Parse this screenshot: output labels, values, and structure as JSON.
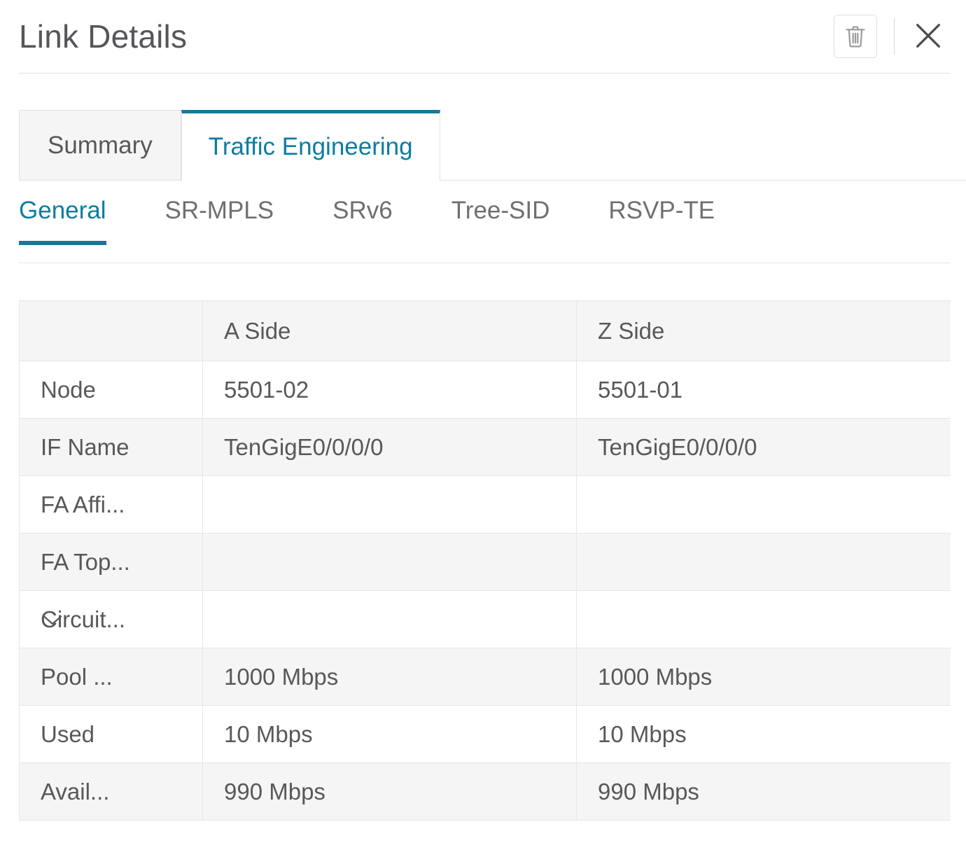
{
  "header": {
    "title": "Link Details",
    "delete_icon": "trash-icon",
    "close_icon": "close-icon"
  },
  "tabs": [
    {
      "label": "Summary",
      "active": false
    },
    {
      "label": "Traffic Engineering",
      "active": true
    }
  ],
  "subtabs": [
    {
      "label": "General",
      "active": true
    },
    {
      "label": "SR-MPLS",
      "active": false
    },
    {
      "label": "SRv6",
      "active": false
    },
    {
      "label": "Tree-SID",
      "active": false
    },
    {
      "label": "RSVP-TE",
      "active": false
    }
  ],
  "table": {
    "columns": [
      "",
      "A Side",
      "Z Side"
    ],
    "rows": [
      {
        "label": "Node",
        "a": "5501-02",
        "z": "5501-01",
        "expandable": false,
        "indented": false
      },
      {
        "label": "IF Name",
        "a": "TenGigE0/0/0/0",
        "z": "TenGigE0/0/0/0",
        "expandable": false,
        "indented": false
      },
      {
        "label": "FA Affi...",
        "a": "",
        "z": "",
        "expandable": false,
        "indented": false
      },
      {
        "label": "FA Top...",
        "a": "",
        "z": "",
        "expandable": false,
        "indented": false
      },
      {
        "label": "Circuit...",
        "a": "",
        "z": "",
        "expandable": true,
        "indented": false
      },
      {
        "label": "Pool ...",
        "a": "1000 Mbps",
        "z": "1000 Mbps",
        "expandable": false,
        "indented": true
      },
      {
        "label": "Used",
        "a": "10 Mbps",
        "z": "10 Mbps",
        "expandable": false,
        "indented": true
      },
      {
        "label": "Avail...",
        "a": "990 Mbps",
        "z": "990 Mbps",
        "expandable": false,
        "indented": true
      }
    ]
  },
  "colors": {
    "accent": "#17789b",
    "accent_text": "#0d7ca1",
    "text": "#58585b",
    "row_stripe": "#f5f5f5",
    "border": "#e6e6e6"
  }
}
